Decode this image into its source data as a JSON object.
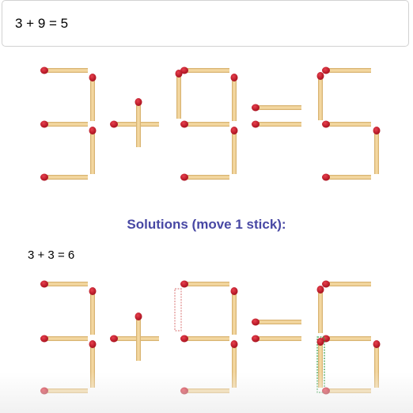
{
  "puzzle": {
    "equation": "3 + 9 = 5"
  },
  "solutions": {
    "heading": "Solutions (move 1 stick):",
    "items": [
      {
        "equation": "3 + 3 = 6"
      }
    ]
  },
  "colors": {
    "stick_wood": "#f3d7a0",
    "stick_edge": "#d9b472",
    "match_head": "#c41a2a",
    "heading": "#4848a4",
    "removed_outline": "#e08b8b",
    "added_outline": "#3aa14a"
  }
}
